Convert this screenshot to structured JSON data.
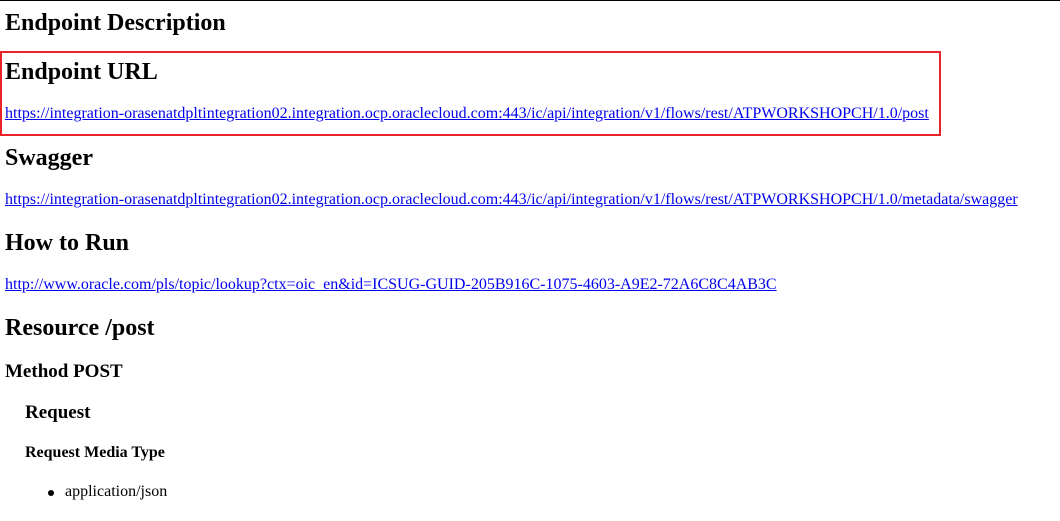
{
  "headings": {
    "endpoint_description": "Endpoint Description",
    "endpoint_url": "Endpoint URL",
    "swagger": "Swagger",
    "how_to_run": "How to Run",
    "resource": "Resource /post",
    "method": "Method POST",
    "request": "Request",
    "request_media_type": "Request Media Type"
  },
  "links": {
    "endpoint_url": "https://integration-orasenatdpltintegration02.integration.ocp.oraclecloud.com:443/ic/api/integration/v1/flows/rest/ATPWORKSHOPCH/1.0/post",
    "swagger_url": "https://integration-orasenatdpltintegration02.integration.ocp.oraclecloud.com:443/ic/api/integration/v1/flows/rest/ATPWORKSHOPCH/1.0/metadata/swagger",
    "how_to_run_url": "http://www.oracle.com/pls/topic/lookup?ctx=oic_en&id=ICSUG-GUID-205B916C-1075-4603-A9E2-72A6C8C4AB3C"
  },
  "media_types": [
    "application/json"
  ],
  "colors": {
    "link": "#0000ee",
    "highlight": "#e8232a"
  }
}
